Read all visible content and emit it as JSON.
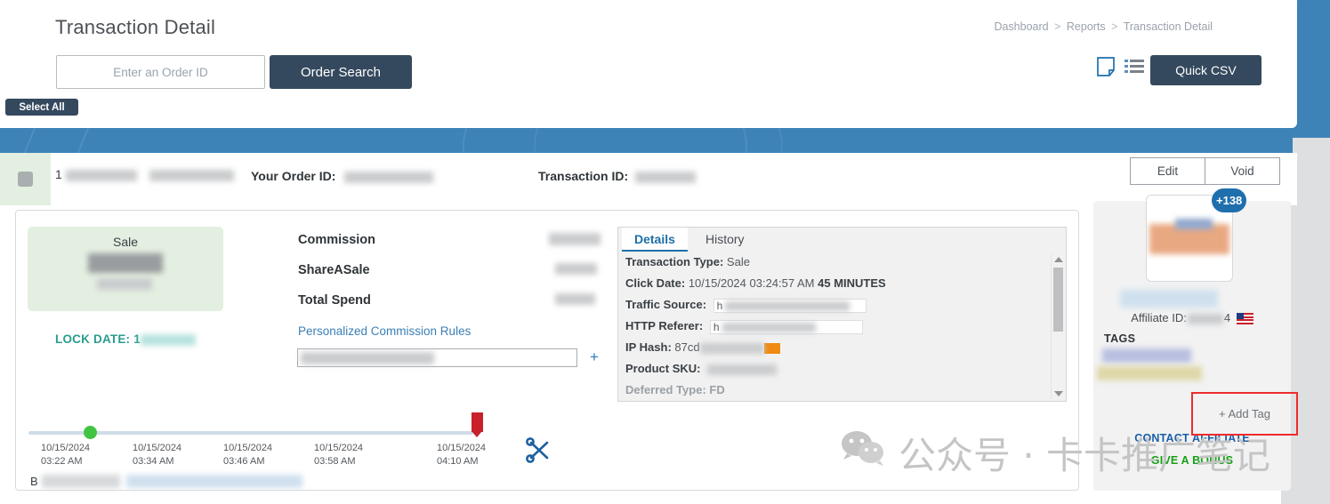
{
  "header": {
    "title": "Transaction Detail",
    "breadcrumb": [
      "Dashboard",
      "Reports",
      "Transaction Detail"
    ],
    "breadcrumb_separator": ">",
    "search_placeholder": "Enter an Order ID",
    "search_value": "",
    "order_search_label": "Order Search",
    "select_all_label": "Select All",
    "quick_csv_label": "Quick CSV",
    "note_icon": "note-icon",
    "list_icon": "list-icon"
  },
  "transaction_row": {
    "id_prefix": "1",
    "your_order_id_label": "Your Order ID:",
    "transaction_id_label": "Transaction ID:",
    "edit_label": "Edit",
    "void_label": "Void"
  },
  "sale_card": {
    "type_label": "Sale",
    "lock_date_label": "LOCK DATE: 1"
  },
  "commission": {
    "rows": [
      {
        "label": "Commission"
      },
      {
        "label": "ShareASale"
      },
      {
        "label": "Total Spend"
      }
    ],
    "rules_link": "Personalized Commission Rules",
    "add_symbol": "+"
  },
  "details_panel": {
    "tabs": [
      {
        "label": "Details",
        "active": true
      },
      {
        "label": "History",
        "active": false
      }
    ],
    "rows": [
      {
        "key": "Transaction Type:",
        "value": "Sale",
        "type": "text"
      },
      {
        "key": "Click Date:",
        "value": "10/15/2024 03:24:57 AM",
        "emphasis": "45 MINUTES",
        "type": "text"
      },
      {
        "key": "Traffic Source:",
        "value": "h",
        "type": "field"
      },
      {
        "key": "HTTP Referer:",
        "value": "h",
        "type": "field"
      },
      {
        "key": "IP Hash:",
        "value": "87cd",
        "type": "redacted"
      },
      {
        "key": "Product SKU:",
        "value": "",
        "type": "redacted"
      },
      {
        "key": "Deferred Type: FD",
        "value": "",
        "type": "clipped"
      }
    ]
  },
  "timeline": {
    "ticks": [
      {
        "date": "10/15/2024",
        "time": "03:22 AM"
      },
      {
        "date": "10/15/2024",
        "time": "03:34 AM"
      },
      {
        "date": "10/15/2024",
        "time": "03:46 AM"
      },
      {
        "date": "10/15/2024",
        "time": "03:58 AM"
      },
      {
        "date": "10/15/2024",
        "time": "04:10 AM"
      }
    ],
    "start_marker_icon": "green-dot-marker",
    "end_marker_icon": "red-flag-marker",
    "scissors_icon": "scissors-icon"
  },
  "sidebar": {
    "badge_count": "+138",
    "affiliate_id_label": "Affiliate ID:",
    "affiliate_id_suffix": "4",
    "country_flag": "us-flag-icon",
    "tags_title": "TAGS",
    "add_tag_label": "+ Add Tag",
    "contact_affiliate_label": "CONTACT AFFILIATE",
    "give_bonus_label": "GIVE A BONUS"
  },
  "watermark": {
    "text": "公众号 · 卡卡推广笔记",
    "icon": "wechat-icon"
  },
  "colors": {
    "brand_blue": "#3d83b8",
    "dark_navy": "#35495e",
    "link_blue": "#3b7fb5",
    "teal": "#2a9d8f",
    "green": "#18a018",
    "red_highlight": "#ee2c2c",
    "sale_green_bg": "#e3efe1"
  }
}
